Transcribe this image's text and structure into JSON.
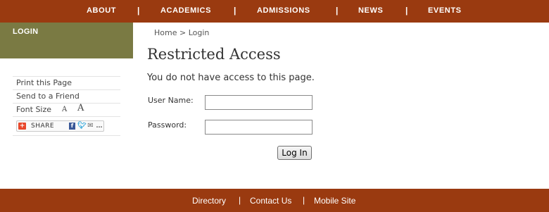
{
  "topnav": {
    "items": [
      "ABOUT",
      "ACADEMICS",
      "ADMISSIONS",
      "NEWS",
      "EVENTS"
    ],
    "separator": "|"
  },
  "sidebar": {
    "title": "LOGIN",
    "tools": {
      "print": "Print this Page",
      "send": "Send to a Friend",
      "font_size_label": "Font Size",
      "font_small": "A",
      "font_large": "A",
      "share_label": "SHARE"
    }
  },
  "breadcrumb": {
    "home": "Home",
    "separator": ">",
    "current": "Login"
  },
  "main": {
    "title": "Restricted Access",
    "message": "You do not have access to this page.",
    "username_label": "User Name:",
    "password_label": "Password:",
    "username_value": "",
    "password_value": "",
    "login_button": "Log In"
  },
  "footer": {
    "items": [
      "Directory",
      "Contact Us",
      "Mobile Site"
    ],
    "separator": "|"
  },
  "colors": {
    "nav_bg": "#9a3a10",
    "sidebar_head_bg": "#7a7a43",
    "share_accent": "#e8482c"
  },
  "icons": {
    "share": "share-plus-icon",
    "facebook": "facebook-icon",
    "twitter": "twitter-icon",
    "email": "email-icon",
    "more": "more-icon"
  }
}
